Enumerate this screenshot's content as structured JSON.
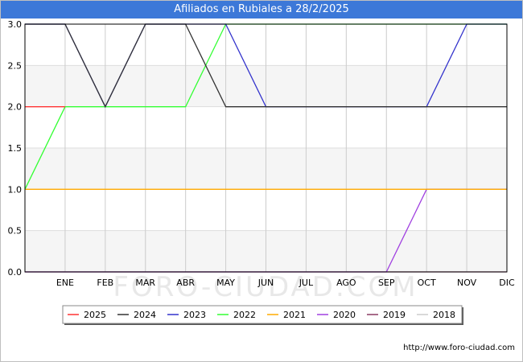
{
  "title": "Afiliados en Rubiales a 28/2/2025",
  "source": "http://www.foro-ciudad.com",
  "watermark": "FORO-CIUDAD.COM",
  "chart_data": {
    "type": "line",
    "categories": [
      "",
      "ENE",
      "FEB",
      "MAR",
      "ABR",
      "MAY",
      "JUN",
      "JUL",
      "AGO",
      "SEP",
      "OCT",
      "NOV",
      "DIC"
    ],
    "ylim": [
      0,
      3
    ],
    "yticks": [
      "0.0",
      "0.5",
      "1.0",
      "1.5",
      "2.0",
      "2.5",
      "3.0"
    ],
    "ytick_values": [
      0,
      0.5,
      1,
      1.5,
      2,
      2.5,
      3
    ],
    "grid": true,
    "legend_position": "bottom",
    "series": [
      {
        "name": "2025",
        "color": "#ff3333",
        "values": [
          2,
          2
        ]
      },
      {
        "name": "2024",
        "color": "#333333",
        "values": [
          3,
          3,
          2,
          3,
          3,
          2,
          2,
          2,
          2,
          2,
          2,
          2,
          2
        ]
      },
      {
        "name": "2023",
        "color": "#3333cc",
        "values": [
          3,
          3,
          2,
          3,
          3,
          3,
          2,
          2,
          2,
          2,
          2,
          3,
          3
        ]
      },
      {
        "name": "2022",
        "color": "#33ff33",
        "values": [
          1,
          2,
          2,
          2,
          2,
          3,
          3,
          3,
          3,
          3,
          3,
          3,
          3
        ]
      },
      {
        "name": "2021",
        "color": "#ffaa00",
        "values": [
          1,
          1,
          1,
          1,
          1,
          1,
          1,
          1,
          1,
          1,
          1,
          1,
          1
        ]
      },
      {
        "name": "2020",
        "color": "#a040e0",
        "values": [
          0,
          0,
          0,
          0,
          0,
          0,
          0,
          0,
          0,
          0,
          1,
          1,
          1
        ]
      },
      {
        "name": "2019",
        "color": "#8b3a62",
        "values": [
          0,
          0,
          0,
          0,
          0,
          0,
          0,
          0,
          0,
          0,
          0,
          0,
          0
        ]
      },
      {
        "name": "2018",
        "color": "#cccccc",
        "values": []
      }
    ]
  }
}
